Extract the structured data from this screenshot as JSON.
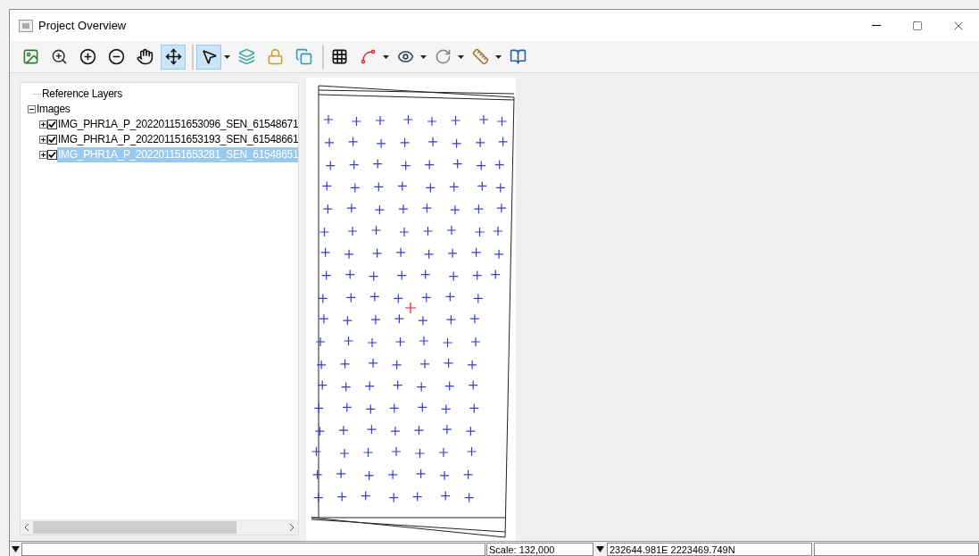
{
  "window": {
    "title": "Project Overview"
  },
  "toolbar": {
    "groups": [
      [
        {
          "selected": false,
          "dropdown": false
        },
        {
          "selected": false,
          "dropdown": false
        },
        {
          "selected": false,
          "dropdown": false
        },
        {
          "selected": false,
          "dropdown": false
        },
        {
          "selected": false,
          "dropdown": false
        },
        {
          "selected": true,
          "dropdown": false
        }
      ],
      [
        {
          "selected": true,
          "dropdown": true
        },
        {
          "selected": false,
          "dropdown": false
        },
        {
          "selected": false,
          "dropdown": false
        },
        {
          "selected": false,
          "dropdown": false
        }
      ],
      [
        {
          "selected": false,
          "dropdown": false
        },
        {
          "selected": false,
          "dropdown": true
        },
        {
          "selected": false,
          "dropdown": true
        },
        {
          "selected": false,
          "dropdown": true
        },
        {
          "selected": false,
          "dropdown": true
        },
        {
          "selected": false,
          "dropdown": false
        }
      ]
    ]
  },
  "tree": [
    {
      "label": "Reference Layers"
    },
    {
      "label": "Images",
      "expanded": true,
      "children": [
        {
          "label": "IMG_PHR1A_P_202201151653096_SEN_61548671",
          "checked": true,
          "selected": false,
          "expanded": false
        },
        {
          "label": "IMG_PHR1A_P_202201151653193_SEN_61548661",
          "checked": true,
          "selected": false,
          "expanded": false
        },
        {
          "label": "IMG_PHR1A_P_202201151653281_SEN_61548651",
          "checked": true,
          "selected": true,
          "expanded": false
        }
      ]
    }
  ],
  "status_bar": {
    "scale": "Scale: 132,000",
    "coordinates": "232644.981E 2223469.749N"
  }
}
